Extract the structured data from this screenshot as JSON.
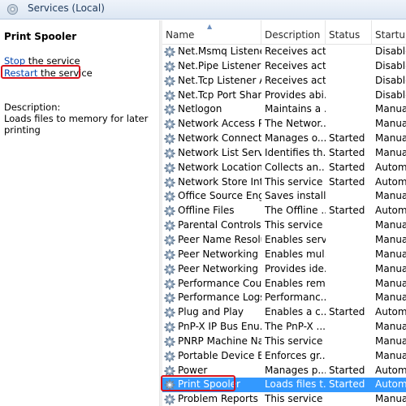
{
  "window": {
    "title": "Services (Local)",
    "icon": "services-gear-icon"
  },
  "left_pane": {
    "service_name": "Print Spooler",
    "stop_link": "Stop",
    "stop_suffix": " the service",
    "restart_link": "Restart",
    "restart_suffix": " the service",
    "description_label": "Description:",
    "description_text": "Loads files to memory for later printing"
  },
  "colors": {
    "highlight_border": "#d8141d",
    "selection": "#3399ff",
    "link": "#0645ad"
  },
  "table": {
    "columns": [
      "Name",
      "Description",
      "Status",
      "Startup"
    ],
    "sorted_column": "Name",
    "sort_direction": "ascending",
    "row_icon": "service-gear-icon",
    "rows": [
      {
        "name": "Net.Msmq Listene...",
        "description": "Receives act...",
        "status": "",
        "startup": "Disable"
      },
      {
        "name": "Net.Pipe Listener ...",
        "description": "Receives act...",
        "status": "",
        "startup": "Disable"
      },
      {
        "name": "Net.Tcp Listener A...",
        "description": "Receives act...",
        "status": "",
        "startup": "Disable"
      },
      {
        "name": "Net.Tcp Port Shari...",
        "description": "Provides abi...",
        "status": "",
        "startup": "Disable"
      },
      {
        "name": "Netlogon",
        "description": "Maintains a ...",
        "status": "",
        "startup": "Manua"
      },
      {
        "name": "Network Access P...",
        "description": "The Networ...",
        "status": "",
        "startup": "Manua"
      },
      {
        "name": "Network Connecti...",
        "description": "Manages o...",
        "status": "Started",
        "startup": "Manua"
      },
      {
        "name": "Network List Service",
        "description": "Identifies th...",
        "status": "Started",
        "startup": "Manua"
      },
      {
        "name": "Network Location ...",
        "description": "Collects an...",
        "status": "Started",
        "startup": "Autom"
      },
      {
        "name": "Network Store Int...",
        "description": "This service ...",
        "status": "Started",
        "startup": "Autom"
      },
      {
        "name": "Office Source Engi...",
        "description": "Saves install...",
        "status": "",
        "startup": "Manua"
      },
      {
        "name": "Offline Files",
        "description": "The Offline ...",
        "status": "Started",
        "startup": "Autom"
      },
      {
        "name": "Parental Controls",
        "description": "This service ...",
        "status": "",
        "startup": "Manua"
      },
      {
        "name": "Peer Name Resolu...",
        "description": "Enables serv...",
        "status": "",
        "startup": "Manua"
      },
      {
        "name": "Peer Networking ...",
        "description": "Enables mul...",
        "status": "",
        "startup": "Manua"
      },
      {
        "name": "Peer Networking I...",
        "description": "Provides ide...",
        "status": "",
        "startup": "Manua"
      },
      {
        "name": "Performance Cou...",
        "description": "Enables rem...",
        "status": "",
        "startup": "Manua"
      },
      {
        "name": "Performance Logs...",
        "description": "Performanc...",
        "status": "",
        "startup": "Manua"
      },
      {
        "name": "Plug and Play",
        "description": "Enables a c...",
        "status": "Started",
        "startup": "Autom"
      },
      {
        "name": "PnP-X IP Bus Enu...",
        "description": "The PnP-X ...",
        "status": "",
        "startup": "Manua"
      },
      {
        "name": "PNRP Machine Na...",
        "description": "This service ...",
        "status": "",
        "startup": "Manua"
      },
      {
        "name": "Portable Device E...",
        "description": "Enforces gr...",
        "status": "",
        "startup": "Manua"
      },
      {
        "name": "Power",
        "description": "Manages p...",
        "status": "Started",
        "startup": "Autom"
      },
      {
        "name": "Print Spooler",
        "description": "Loads files t...",
        "status": "Started",
        "startup": "Autom",
        "selected": true
      },
      {
        "name": "Problem Reports a...",
        "description": "This service ...",
        "status": "",
        "startup": "Manua"
      }
    ]
  }
}
